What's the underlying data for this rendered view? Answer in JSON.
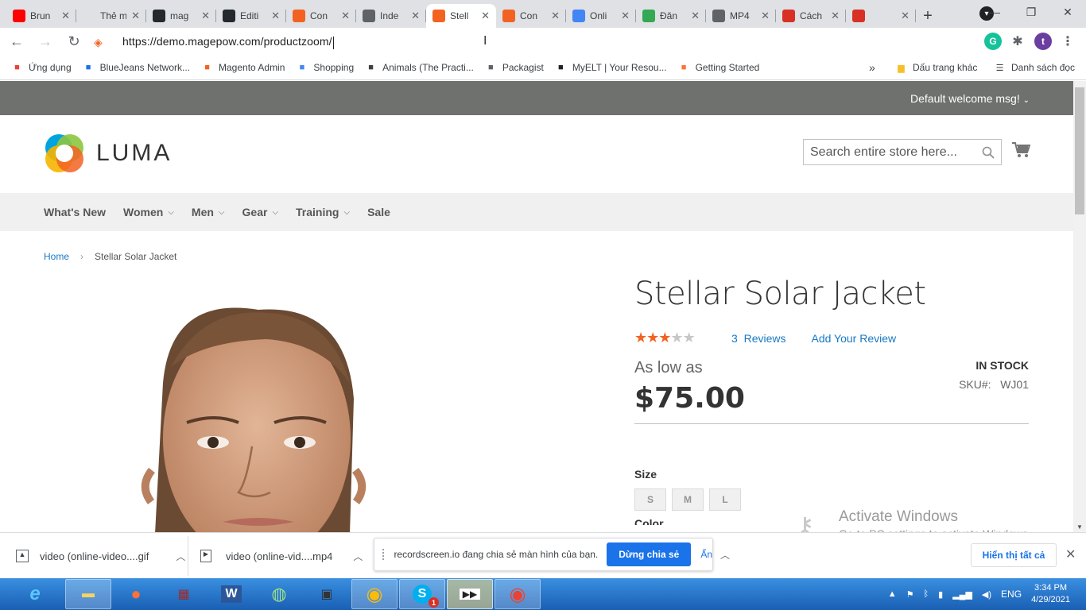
{
  "browser": {
    "tabs": [
      {
        "title": "Brun",
        "icon": "youtube-icon",
        "color": "#ff0000"
      },
      {
        "title": "Thẻ mới",
        "icon": "blank-icon",
        "color": "#dfe1e5"
      },
      {
        "title": "mag",
        "icon": "github-icon",
        "color": "#24292e"
      },
      {
        "title": "Editi",
        "icon": "github-icon",
        "color": "#24292e"
      },
      {
        "title": "Con",
        "icon": "magento-icon",
        "color": "#f26322"
      },
      {
        "title": "Inde",
        "icon": "globe-icon",
        "color": "#5f6368"
      },
      {
        "title": "Stell",
        "icon": "magento-icon",
        "color": "#f26322",
        "active": true
      },
      {
        "title": "Con",
        "icon": "magento-icon",
        "color": "#f26322"
      },
      {
        "title": "Onli",
        "icon": "dots-icon",
        "color": "#4285f4"
      },
      {
        "title": "Đăn",
        "icon": "green-i-icon",
        "color": "#34a853"
      },
      {
        "title": "MP4",
        "icon": "cloud-icon",
        "color": "#5f6368"
      },
      {
        "title": "Cách",
        "icon": "red-square-icon",
        "color": "#d93025"
      },
      {
        "title": "",
        "icon": "recording-icon",
        "color": "#d93025"
      }
    ],
    "url": "https://demo.magepow.com/productzoom/",
    "bookmarks": [
      {
        "label": "Ứng dụng",
        "icon": "apps-grid-icon",
        "color": "#ea4335"
      },
      {
        "label": "BlueJeans Network...",
        "icon": "bluejeans-icon",
        "color": "#1a73e8"
      },
      {
        "label": "Magento Admin",
        "icon": "magento-icon",
        "color": "#f26322"
      },
      {
        "label": "Shopping",
        "icon": "google-icon",
        "color": "#4285f4"
      },
      {
        "label": "Animals (The Practi...",
        "icon": "diamond-icon",
        "color": "#3c4043"
      },
      {
        "label": "Packagist",
        "icon": "packagist-icon",
        "color": "#5f6368"
      },
      {
        "label": "MyELT | Your Resou...",
        "icon": "e-icon",
        "color": "#202124"
      },
      {
        "label": "Getting Started",
        "icon": "firefox-icon",
        "color": "#ff7139"
      }
    ],
    "bookmarks_more": "»",
    "other_bookmarks": "Dấu trang khác",
    "reading_list": "Danh sách đọc",
    "profile_letter": "t"
  },
  "store": {
    "welcome": "Default welcome msg!",
    "logo_text": "LUMA",
    "search_placeholder": "Search entire store here...",
    "nav": [
      {
        "label": "What's New",
        "has_menu": false
      },
      {
        "label": "Women",
        "has_menu": true
      },
      {
        "label": "Men",
        "has_menu": true
      },
      {
        "label": "Gear",
        "has_menu": true
      },
      {
        "label": "Training",
        "has_menu": true
      },
      {
        "label": "Sale",
        "has_menu": false
      }
    ],
    "breadcrumb": {
      "home": "Home",
      "current": "Stellar Solar Jacket"
    }
  },
  "product": {
    "name": "Stellar Solar Jacket",
    "rating": 3,
    "rating_max": 5,
    "reviews_count": "3",
    "reviews_label": "Reviews",
    "add_review": "Add Your Review",
    "price_prefix": "As low as",
    "price": "$75.00",
    "stock": "IN STOCK",
    "sku_label": "SKU#:",
    "sku": "WJ01",
    "size_label": "Size",
    "sizes": [
      "S",
      "M",
      "L"
    ],
    "color_label": "Color"
  },
  "windows_watermark": {
    "line1": "Activate Windows",
    "line2": "Go to PC settings to activate Windows."
  },
  "downloads": {
    "items": [
      "video (online-video....gif",
      "video (online-vid....mp4"
    ],
    "share_message": "recordscreen.io đang chia sẻ màn hình của bạn.",
    "stop_sharing": "Dừng chia sẻ",
    "hide": "Ẩn",
    "show_all": "Hiển thị tất cả"
  },
  "taskbar": {
    "language": "ENG",
    "time": "3:34 PM",
    "date": "4/29/2021",
    "skype_badge": "1"
  }
}
